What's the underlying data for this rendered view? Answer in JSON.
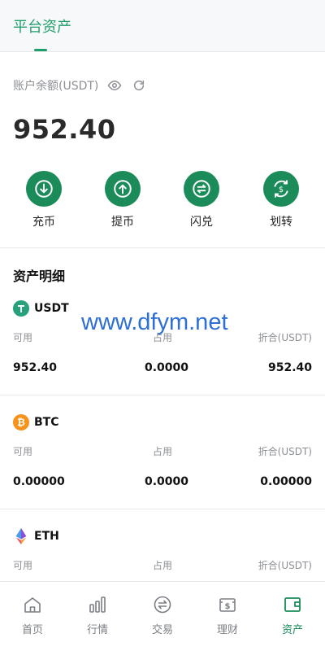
{
  "header": {
    "tab_label": "平台资产"
  },
  "balance": {
    "label": "账户余额(USDT)",
    "value": "952.40"
  },
  "actions": [
    {
      "label": "充币",
      "icon": "deposit-icon"
    },
    {
      "label": "提币",
      "icon": "withdraw-icon"
    },
    {
      "label": "闪兑",
      "icon": "flash-exchange-icon"
    },
    {
      "label": "划转",
      "icon": "transfer-icon"
    }
  ],
  "section_title": "资产明细",
  "assets": [
    {
      "name": "USDT",
      "available_label": "可用",
      "available": "952.40",
      "occupied_label": "占用",
      "occupied": "0.0000",
      "converted_label": "折合(USDT)",
      "converted": "952.40",
      "icon_color": "#26a17b"
    },
    {
      "name": "BTC",
      "available_label": "可用",
      "available": "0.00000",
      "occupied_label": "占用",
      "occupied": "0.0000",
      "converted_label": "折合(USDT)",
      "converted": "0.00000",
      "icon_color": "#f7931a"
    },
    {
      "name": "ETH",
      "available_label": "可用",
      "occupied_label": "占用",
      "converted_label": "折合(USDT)"
    }
  ],
  "watermark": "www.dfym.net",
  "tabbar": [
    {
      "label": "首页",
      "icon": "home-icon"
    },
    {
      "label": "行情",
      "icon": "market-chart-icon"
    },
    {
      "label": "交易",
      "icon": "trade-icon"
    },
    {
      "label": "理财",
      "icon": "finance-icon"
    },
    {
      "label": "资产",
      "icon": "wallet-icon",
      "active": true
    }
  ],
  "colors": {
    "accent": "#1b8b5a",
    "header_accent": "#1e9e6a",
    "watermark": "#2e6fd6"
  }
}
